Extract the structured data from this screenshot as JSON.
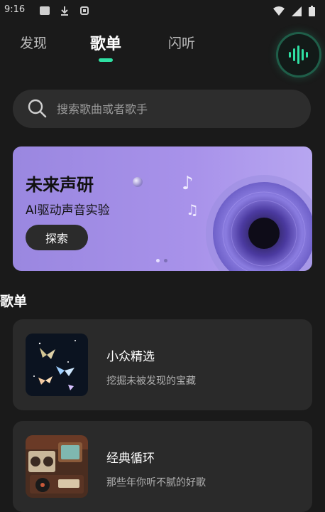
{
  "status_bar": {
    "time": "9:16",
    "icons_left": [
      "notification-square-icon",
      "download-icon",
      "android-icon"
    ],
    "icons_right": [
      "wifi-icon",
      "signal-icon",
      "battery-icon"
    ]
  },
  "tabs": [
    {
      "label": "发现",
      "active": false
    },
    {
      "label": "歌单",
      "active": true
    },
    {
      "label": "闪听",
      "active": false
    }
  ],
  "voice_button": {
    "icon": "sound-wave-icon",
    "accent": "#2fe0a3"
  },
  "search": {
    "placeholder": "搜索歌曲或者歌手",
    "icon": "search-icon"
  },
  "banner": {
    "title": "未来声研",
    "subtitle": "AI驱动声音实验",
    "button_label": "探索",
    "background": "#a892ea",
    "page_count": 2,
    "active_page": 1
  },
  "section": {
    "title": "歌单"
  },
  "playlists": [
    {
      "title": "小众精选",
      "subtitle": "挖掘未被发现的宝藏",
      "thumb": "glowing-butterflies-image"
    },
    {
      "title": "经典循环",
      "subtitle": "那些年你听不腻的好歌",
      "thumb": "retro-radio-tv-image"
    }
  ]
}
